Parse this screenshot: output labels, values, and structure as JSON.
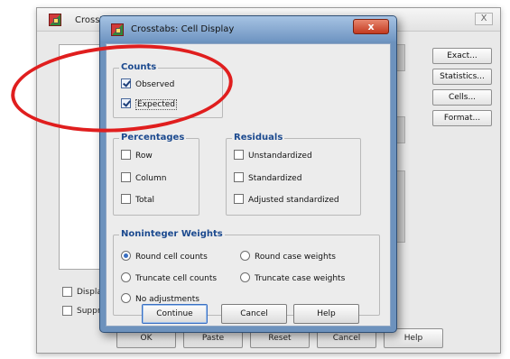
{
  "background_window": {
    "title": "Crosstab",
    "close_label": "X",
    "side_buttons": [
      "Exact...",
      "Statistics...",
      "Cells...",
      "Format..."
    ],
    "checkboxes": [
      "Displa",
      "Suppr"
    ],
    "bottom_buttons": [
      "OK",
      "Paste",
      "Reset",
      "Cancel",
      "Help"
    ]
  },
  "dialog": {
    "title": "Crosstabs: Cell Display",
    "close_label": "x",
    "counts": {
      "title": "Counts",
      "items": [
        {
          "label": "Observed",
          "checked": true
        },
        {
          "label": "Expected",
          "checked": true
        }
      ]
    },
    "percentages": {
      "title": "Percentages",
      "items": [
        {
          "label": "Row",
          "checked": false
        },
        {
          "label": "Column",
          "checked": false
        },
        {
          "label": "Total",
          "checked": false
        }
      ]
    },
    "residuals": {
      "title": "Residuals",
      "items": [
        {
          "label": "Unstandardized",
          "checked": false
        },
        {
          "label": "Standardized",
          "checked": false
        },
        {
          "label": "Adjusted standardized",
          "checked": false
        }
      ]
    },
    "noninteger_weights": {
      "title": "Noninteger Weights",
      "options": [
        {
          "label": "Round cell counts",
          "selected": true
        },
        {
          "label": "Round case weights",
          "selected": false
        },
        {
          "label": "Truncate cell counts",
          "selected": false
        },
        {
          "label": "Truncate case weights",
          "selected": false
        },
        {
          "label": "No adjustments",
          "selected": false
        }
      ]
    },
    "buttons": {
      "continue": "Continue",
      "cancel": "Cancel",
      "help": "Help"
    }
  },
  "colors": {
    "group_title": "#1c4a8f",
    "annotation_red": "#e01e1e",
    "dialog_frame": "#6d92bd"
  }
}
